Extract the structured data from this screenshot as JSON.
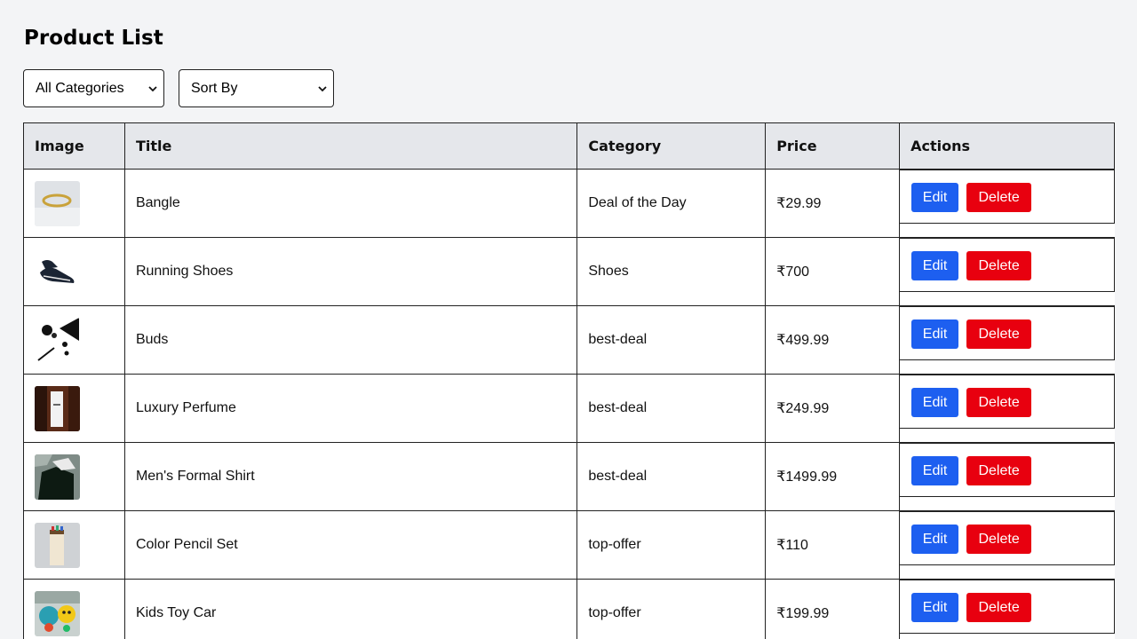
{
  "page": {
    "title": "Product List"
  },
  "filters": {
    "category": {
      "selected": "All Categories"
    },
    "sort": {
      "selected": "Sort By"
    }
  },
  "table": {
    "headers": [
      "Image",
      "Title",
      "Category",
      "Price",
      "Actions"
    ],
    "rows": [
      {
        "title": "Bangle",
        "category": "Deal of the Day",
        "price": "₹29.99",
        "image": "bangle"
      },
      {
        "title": "Running Shoes",
        "category": "Shoes",
        "price": "₹700",
        "image": "shoes"
      },
      {
        "title": "Buds",
        "category": "best-deal",
        "price": "₹499.99",
        "image": "buds"
      },
      {
        "title": "Luxury Perfume",
        "category": "best-deal",
        "price": "₹249.99",
        "image": "perfume"
      },
      {
        "title": "Men's Formal Shirt",
        "category": "best-deal",
        "price": "₹1499.99",
        "image": "shirt"
      },
      {
        "title": "Color Pencil Set",
        "category": "top-offer",
        "price": "₹110",
        "image": "pencils"
      },
      {
        "title": "Kids Toy Car",
        "category": "top-offer",
        "price": "₹199.99",
        "image": "toy-car"
      }
    ],
    "edit_label": "Edit",
    "delete_label": "Delete"
  },
  "colors": {
    "edit": "#1d5ff0",
    "delete": "#e8000f",
    "header_bg": "#e5e7eb",
    "page_bg": "#f3f4f6"
  }
}
